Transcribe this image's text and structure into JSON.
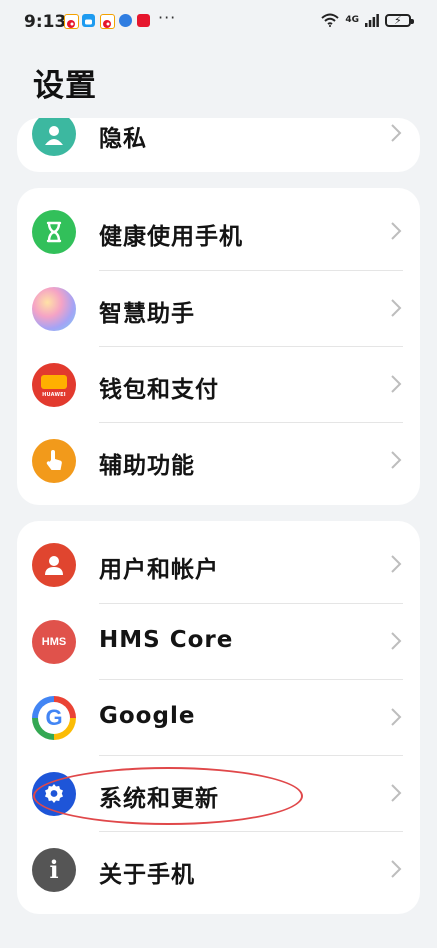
{
  "status_bar": {
    "time": "9:13",
    "more_indicator": "···",
    "network_label": "4G",
    "icons": [
      "weibo-icon",
      "message-icon",
      "weibo-icon",
      "browser-icon",
      "app-badge-icon",
      "wifi-icon",
      "cellular-signal-icon",
      "battery-charging-icon"
    ]
  },
  "header": {
    "title": "设置"
  },
  "groups": [
    {
      "items": [
        {
          "label": "隐私",
          "icon": "privacy-icon",
          "color": "#3cb8a0"
        }
      ]
    },
    {
      "items": [
        {
          "label": "健康使用手机",
          "icon": "hourglass-icon",
          "color": "#32c05a"
        },
        {
          "label": "智慧助手",
          "icon": "assistant-orb-icon",
          "color": "#b6a0f0"
        },
        {
          "label": "钱包和支付",
          "icon": "wallet-icon",
          "color": "#e23a2e",
          "badge_text": "HUAWEI"
        },
        {
          "label": "辅助功能",
          "icon": "hand-touch-icon",
          "color": "#f29a1b"
        }
      ]
    },
    {
      "items": [
        {
          "label": "用户和帐户",
          "icon": "user-icon",
          "color": "#e0452f"
        },
        {
          "label": "HMS Core",
          "icon": "hms-core-icon",
          "color": "#e0524b",
          "badge_text": "HMS"
        },
        {
          "label": "Google",
          "icon": "google-icon",
          "color": "#4285f4"
        },
        {
          "label": "系统和更新",
          "icon": "settings-gear-icon",
          "color": "#1e55d8"
        },
        {
          "label": "关于手机",
          "icon": "info-icon",
          "color": "#555555"
        }
      ]
    }
  ],
  "colors": {
    "background": "#f1f3f5",
    "card": "#ffffff",
    "annotation": "#e0484a"
  }
}
